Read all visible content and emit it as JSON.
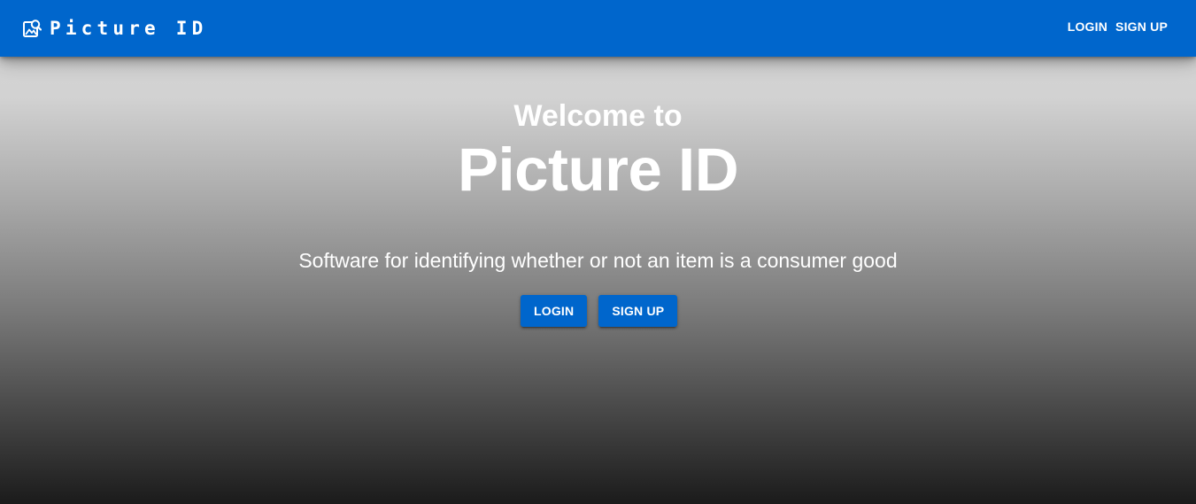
{
  "appbar": {
    "logo_icon": "image-search-icon",
    "brand_name": "Picture ID",
    "nav": {
      "login_label": "LOGIN",
      "signup_label": "SIGN UP"
    },
    "color": "#0066cc"
  },
  "hero": {
    "welcome": "Welcome to",
    "title": "Picture ID",
    "subtitle": "Software for identifying whether or not an item is a consumer good",
    "buttons": {
      "login_label": "LOGIN",
      "signup_label": "SIGN UP"
    }
  }
}
